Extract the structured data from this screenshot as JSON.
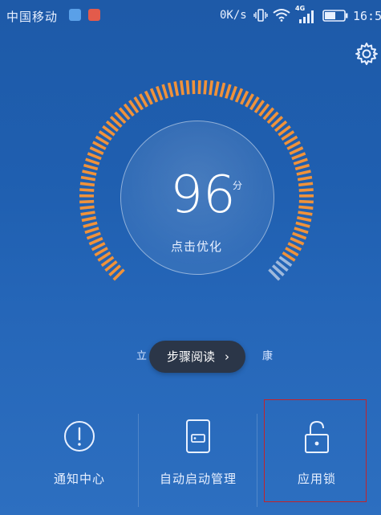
{
  "status_bar": {
    "carrier": "中国移动",
    "speed": "0K/s",
    "network": "4G",
    "time": "16:5"
  },
  "main": {
    "score": "96",
    "score_unit": "分",
    "action_label": "点击优化",
    "hint_left": "立",
    "hint_right": "康"
  },
  "toast": {
    "label": "步骤阅读",
    "chevron": "›"
  },
  "shortcuts": [
    {
      "label": "通知中心",
      "icon": "exclamation-circle-icon"
    },
    {
      "label": "自动启动管理",
      "icon": "auto-start-icon"
    },
    {
      "label": "应用锁",
      "icon": "unlocked-padlock-icon"
    }
  ],
  "colors": {
    "background": "#1f5fb0",
    "gauge_active": "#f0923a",
    "gauge_inactive": "#9fb9dc",
    "highlight": "#c4232a"
  }
}
